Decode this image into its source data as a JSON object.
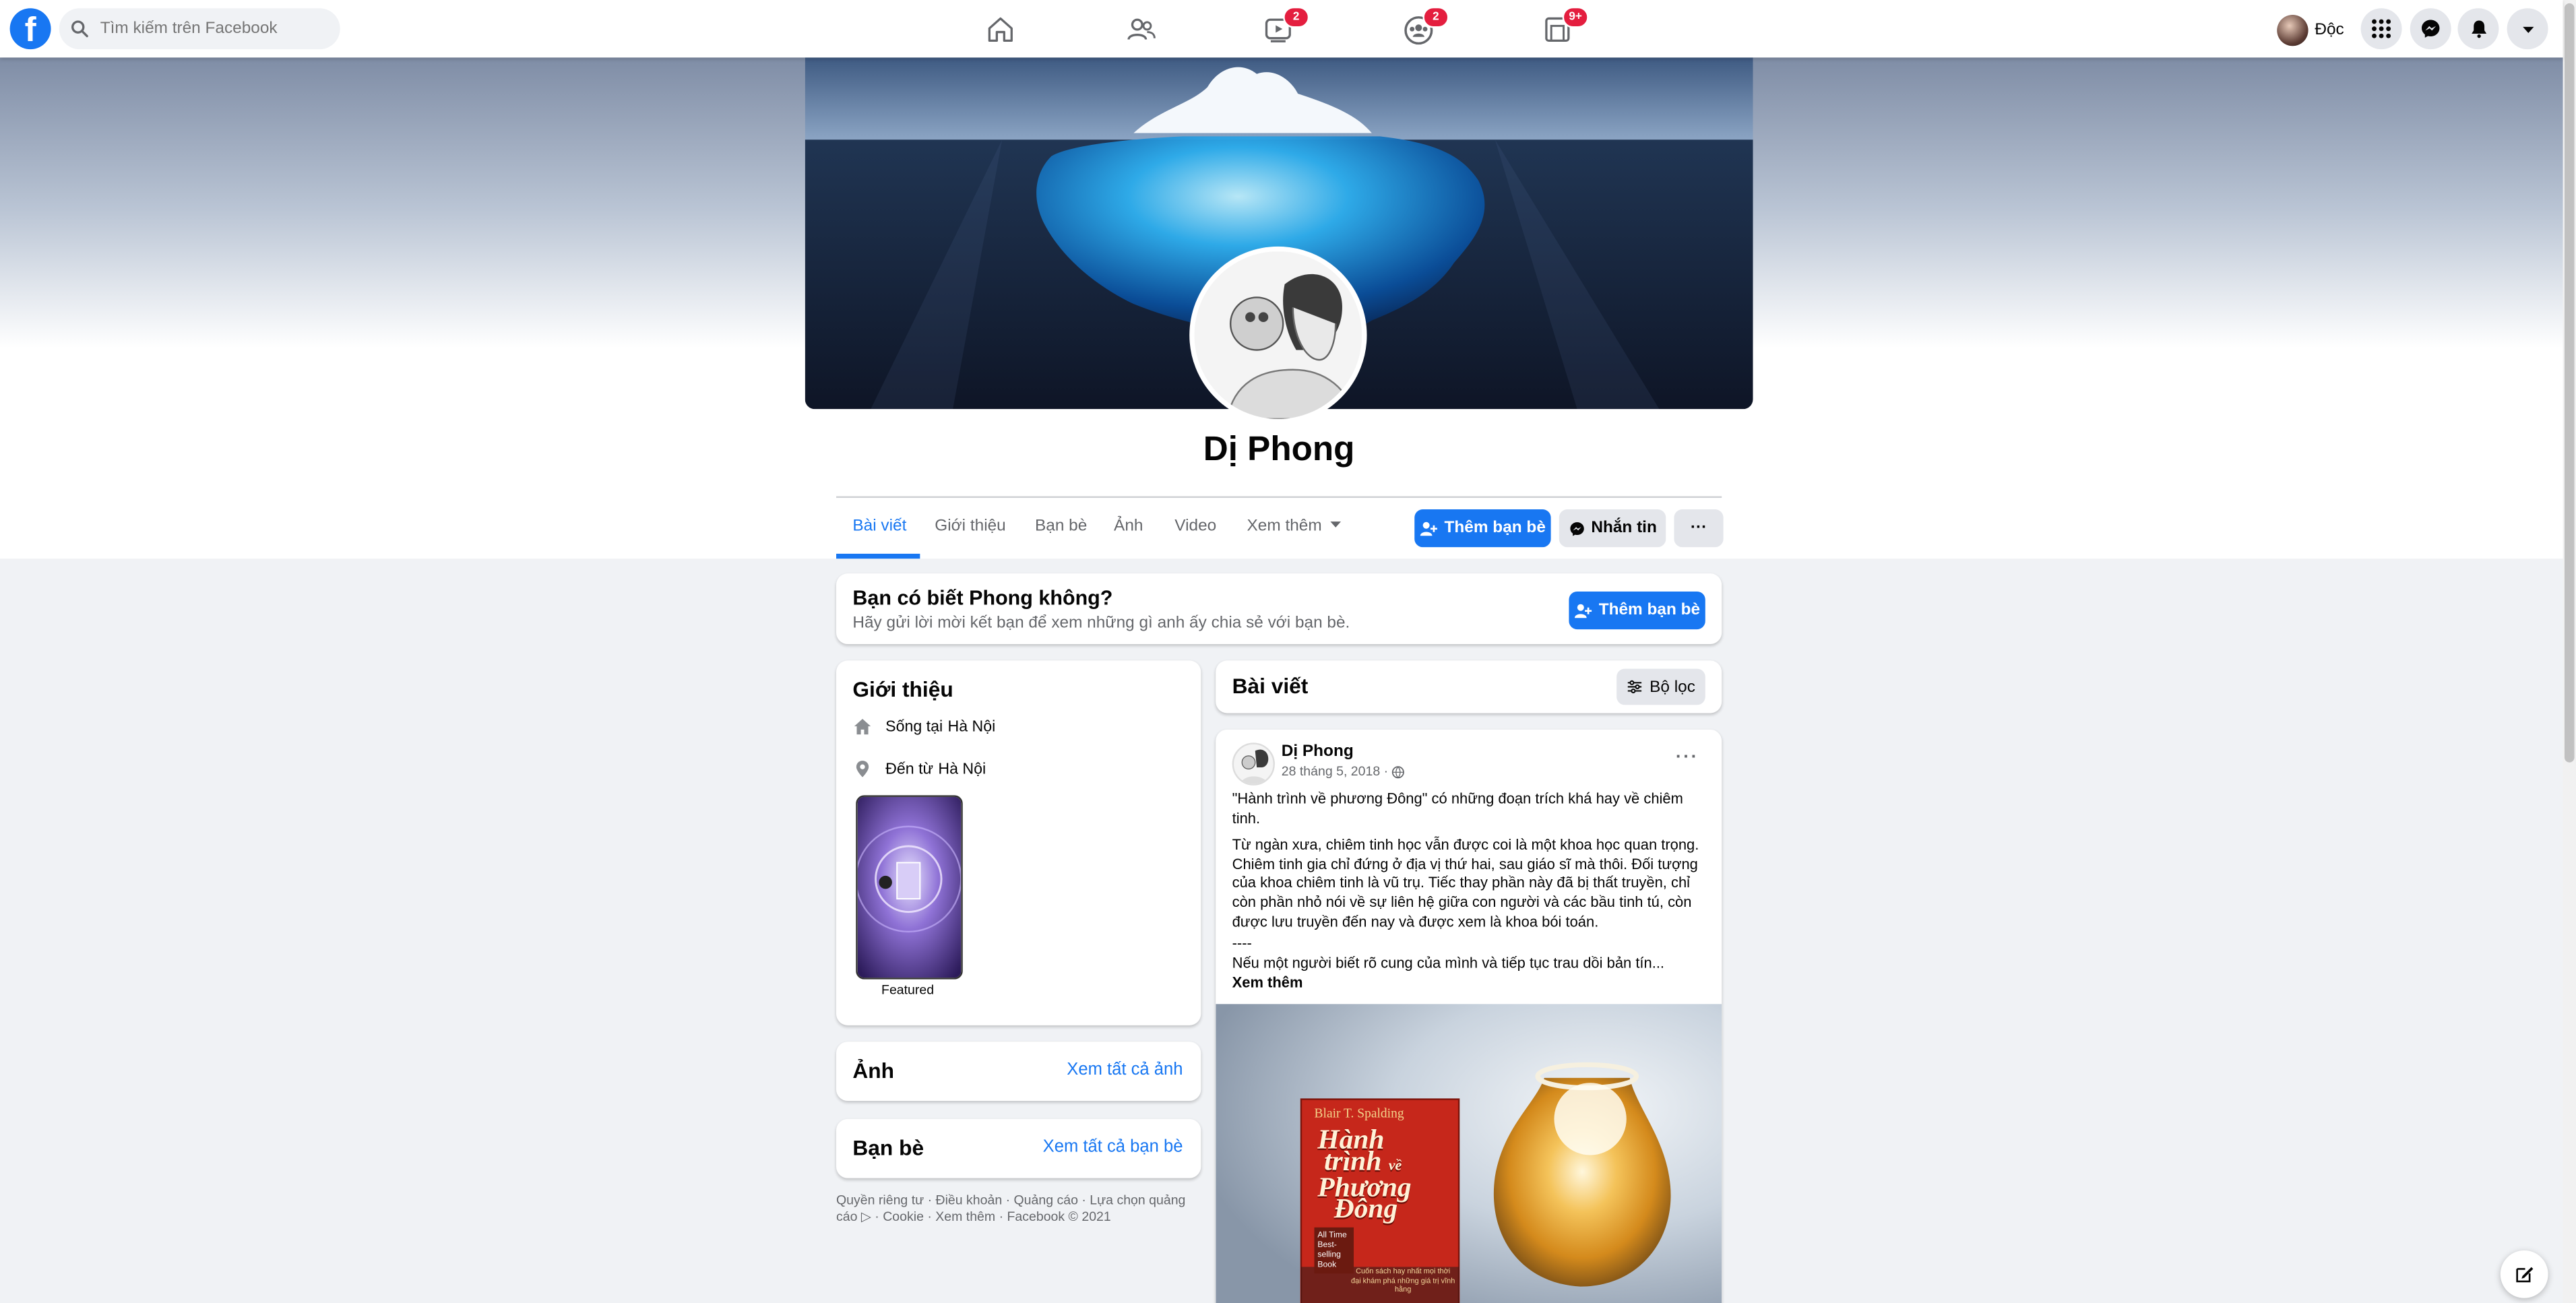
{
  "topnav": {
    "logo": "f",
    "search_placeholder": "Tìm kiếm trên Facebook",
    "icons": [
      "home-icon",
      "friends-icon",
      "watch-icon",
      "groups-icon",
      "gaming-icon"
    ],
    "badges": {
      "watch": "2",
      "groups": "2",
      "gaming": "9+"
    },
    "user_name": "Độc",
    "right_buttons": [
      "menu-grid-icon",
      "messenger-icon",
      "notifications-icon",
      "account-caret-icon"
    ]
  },
  "profile": {
    "name": "Dị Phong",
    "tabs": [
      "Bài viết",
      "Giới thiệu",
      "Bạn bè",
      "Ảnh",
      "Video",
      "Xem thêm"
    ],
    "add_friend_label": "Thêm bạn bè",
    "message_label": "Nhắn tin",
    "more_label": "···"
  },
  "know_card": {
    "title": "Bạn có biết Phong không?",
    "subtitle": "Hãy gửi lời mời kết bạn để xem những gì anh ấy chia sẻ với bạn bè.",
    "button": "Thêm bạn bè"
  },
  "intro": {
    "title": "Giới thiệu",
    "lives_prefix": "Sống tại ",
    "lives_city": "Hà Nội",
    "from_prefix": "Đến từ ",
    "from_city": "Hà Nội",
    "featured_label": "Featured"
  },
  "photos": {
    "title": "Ảnh",
    "link": "Xem tất cả ảnh"
  },
  "friends": {
    "title": "Bạn bè",
    "link": "Xem tất cả bạn bè"
  },
  "footer": {
    "line1": "Quyền riêng tư · Điều khoản · Quảng cáo · Lựa chọn quảng",
    "line2": "cáo ▷ · Cookie · Xem thêm · Facebook © 2021"
  },
  "posts_header": {
    "title": "Bài viết",
    "filter": "Bộ lọc"
  },
  "post": {
    "author": "Dị Phong",
    "date": "28 tháng 5, 2018 · ",
    "more": "···",
    "p1": "\"Hành trình về phương Đông\" có những đoạn trích khá hay về chiêm tinh.",
    "p2": "Từ ngàn xưa, chiêm tinh học vẫn được coi là một khoa học quan trọng. Chiêm tinh gia chỉ đứng ở địa vị thứ hai, sau giáo sĩ mà thôi. Đối tượng của khoa chiêm tinh là vũ trụ. Tiếc thay phần này đã bị thất truyền, chỉ còn phần nhỏ nói về sự liên hệ giữa con người và các bầu tinh tú, còn được lưu truyền đến nay và được xem là khoa bói toán.",
    "p3": "----",
    "p4": "Nếu một người biết rõ cung của mình và tiếp tục trau dồi bản tín...",
    "see_more": "Xem thêm",
    "book": {
      "author": "Blair T. Spalding",
      "title_line1": "Hành",
      "title_line2": "trình",
      "title_line3": "về",
      "title_line4": "Phương",
      "title_line5": "Đông",
      "tag": "All Time Best-selling Book",
      "tagline": "Cuốn sách hay nhất mọi thời đại khám phá những giá trị vĩnh hằng"
    }
  },
  "colors": {
    "accent": "#1877f2",
    "badge": "#e41e3f",
    "page_bg": "#f0f2f5"
  }
}
